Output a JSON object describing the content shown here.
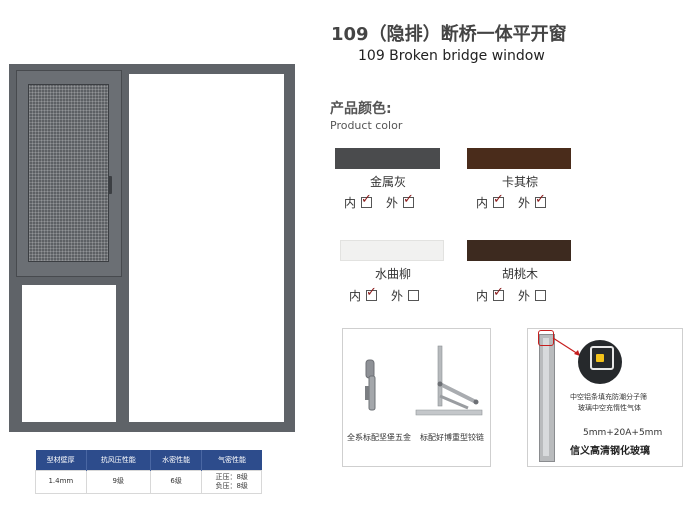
{
  "header": {
    "title_cn": "109（隐排）断桥一体平开窗",
    "title_en": "109 Broken bridge window"
  },
  "colors_section": {
    "title_cn": "产品颜色:",
    "title_en": "Product color"
  },
  "options": {
    "inner": "内",
    "outer": "外"
  },
  "colors": [
    {
      "name": "金属灰",
      "swatch": "#4a4b4d",
      "inner_checked": true,
      "outer_checked": true
    },
    {
      "name": "卡其棕",
      "swatch": "#4a2c1b",
      "inner_checked": true,
      "outer_checked": true
    },
    {
      "name": "水曲柳",
      "swatch": "#f1f1f0",
      "inner_checked": true,
      "outer_checked": false
    },
    {
      "name": "胡桃木",
      "swatch": "#3d2a1f",
      "inner_checked": true,
      "outer_checked": false
    }
  ],
  "spec_table": {
    "headers": [
      "型材壁厚",
      "抗风压性能",
      "水密性能",
      "气密性能"
    ],
    "values": [
      "1.4mm",
      "9级",
      "6级"
    ],
    "airtight_lines": [
      "正压：8级",
      "负压：8级"
    ]
  },
  "hardware_card": {
    "caption_left": "全系标配坚堡五金",
    "caption_right": "标配好博重型铰链"
  },
  "glass_card": {
    "callout_line1": "中空铝条填充防潮分子筛",
    "callout_line2": "玻璃中空充惰性气体",
    "spec": "5mm+20A+5mm",
    "name": "信义高清钢化玻璃"
  },
  "ui_colors": {
    "frame": "#5f6368",
    "table_header": "#2d4c8c",
    "check": "#8a1c1c"
  }
}
